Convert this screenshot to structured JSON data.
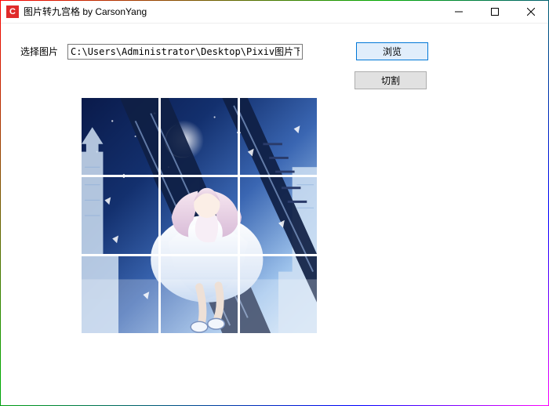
{
  "window": {
    "title": "图片转九宫格 by CarsonYang",
    "icon_letter": "C"
  },
  "form": {
    "select_label": "选择图片",
    "path_value": "C:\\Users\\Administrator\\Desktop\\Pixiv图片下载\\Pixiv_",
    "browse_label": "浏览",
    "cut_label": "切割"
  },
  "grid": {
    "rows": 3,
    "cols": 3
  }
}
